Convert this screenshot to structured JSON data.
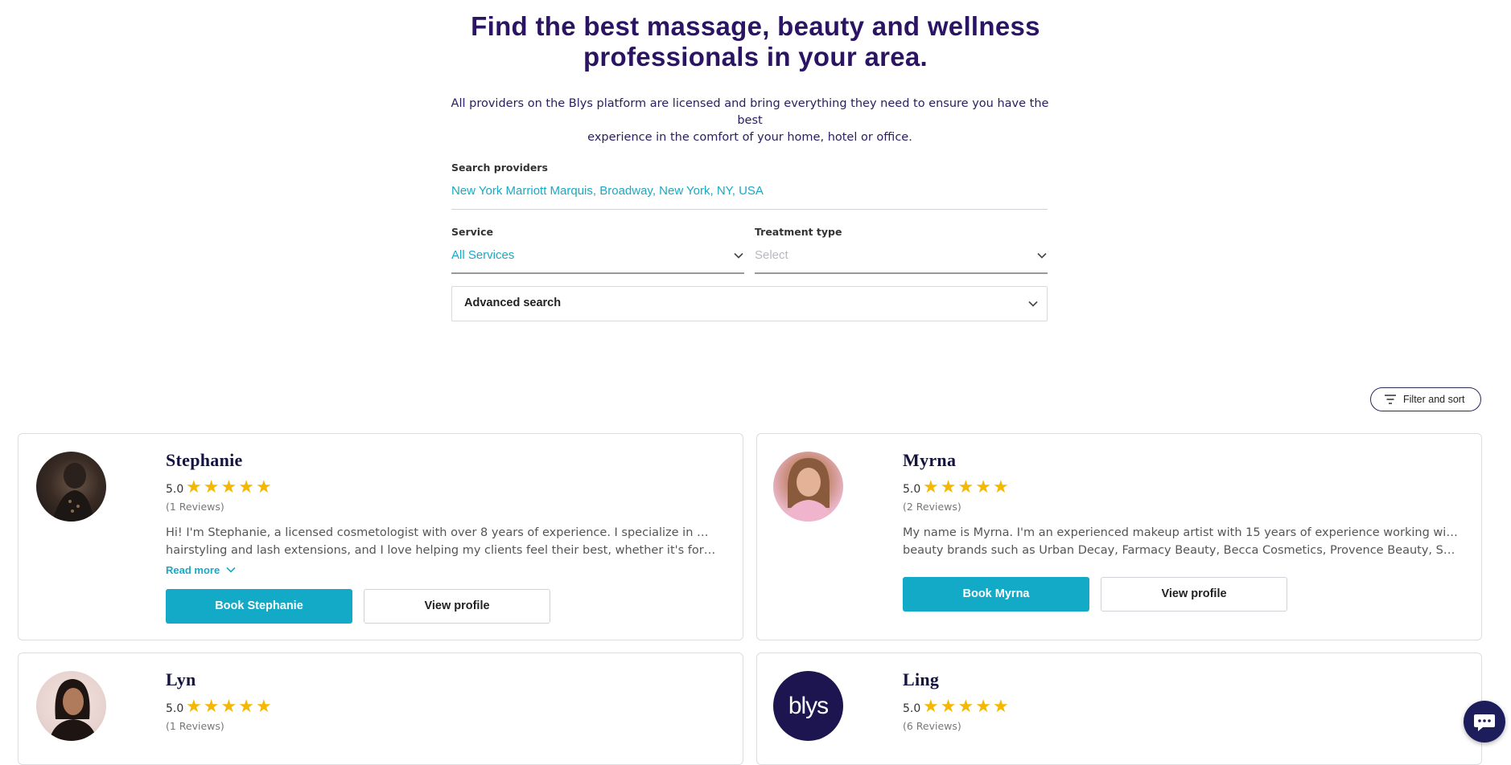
{
  "hero": {
    "title_line1": "Find the best massage, beauty and wellness",
    "title_line2": "professionals in your area.",
    "subtitle_line1": "All providers on the Blys platform are licensed and bring everything they need to ensure you have the best",
    "subtitle_line2": "experience in the comfort of your home, hotel or office."
  },
  "search": {
    "label": "Search providers",
    "value": "New York Marriott Marquis, Broadway, New York, NY, USA",
    "service_label": "Service",
    "service_value": "All Services",
    "treatment_label": "Treatment type",
    "treatment_placeholder": "Select",
    "advanced_label": "Advanced search"
  },
  "filter": {
    "label": "Filter and sort"
  },
  "providers": [
    {
      "name": "Stephanie",
      "rating": "5.0",
      "stars": 5,
      "reviews": "(1 Reviews)",
      "desc_line1": "Hi! I'm Stephanie, a licensed cosmetologist with over 8 years of experience. I specialize in mobile",
      "desc_line2": "hairstyling and lash extensions, and I love helping my clients feel their best, whether it's for a special...",
      "read_more": "Read more",
      "book_label": "Book Stephanie",
      "view_label": "View profile"
    },
    {
      "name": "Myrna",
      "rating": "5.0",
      "stars": 5,
      "reviews": "(2 Reviews)",
      "desc_line1": "My name is Myrna. I'm an experienced makeup artist with 15 years of experience working with top",
      "desc_line2": "beauty brands such as Urban Decay, Farmacy Beauty, Becca Cosmetics, Provence Beauty, Sephora, an...",
      "book_label": "Book Myrna",
      "view_label": "View profile"
    },
    {
      "name": "Lyn",
      "rating": "5.0",
      "stars": 5,
      "reviews": "(1 Reviews)"
    },
    {
      "name": "Ling",
      "rating": "5.0",
      "stars": 5,
      "reviews": "(6 Reviews)",
      "avatar_logo": "blys"
    }
  ],
  "icons": {
    "chevron": "chevron-down-icon",
    "filter": "filter-icon",
    "chat": "chat-icon",
    "star": "star-icon"
  },
  "colors": {
    "brand_navy": "#2a1463",
    "accent_teal": "#12aac6",
    "star": "#f5b800"
  }
}
